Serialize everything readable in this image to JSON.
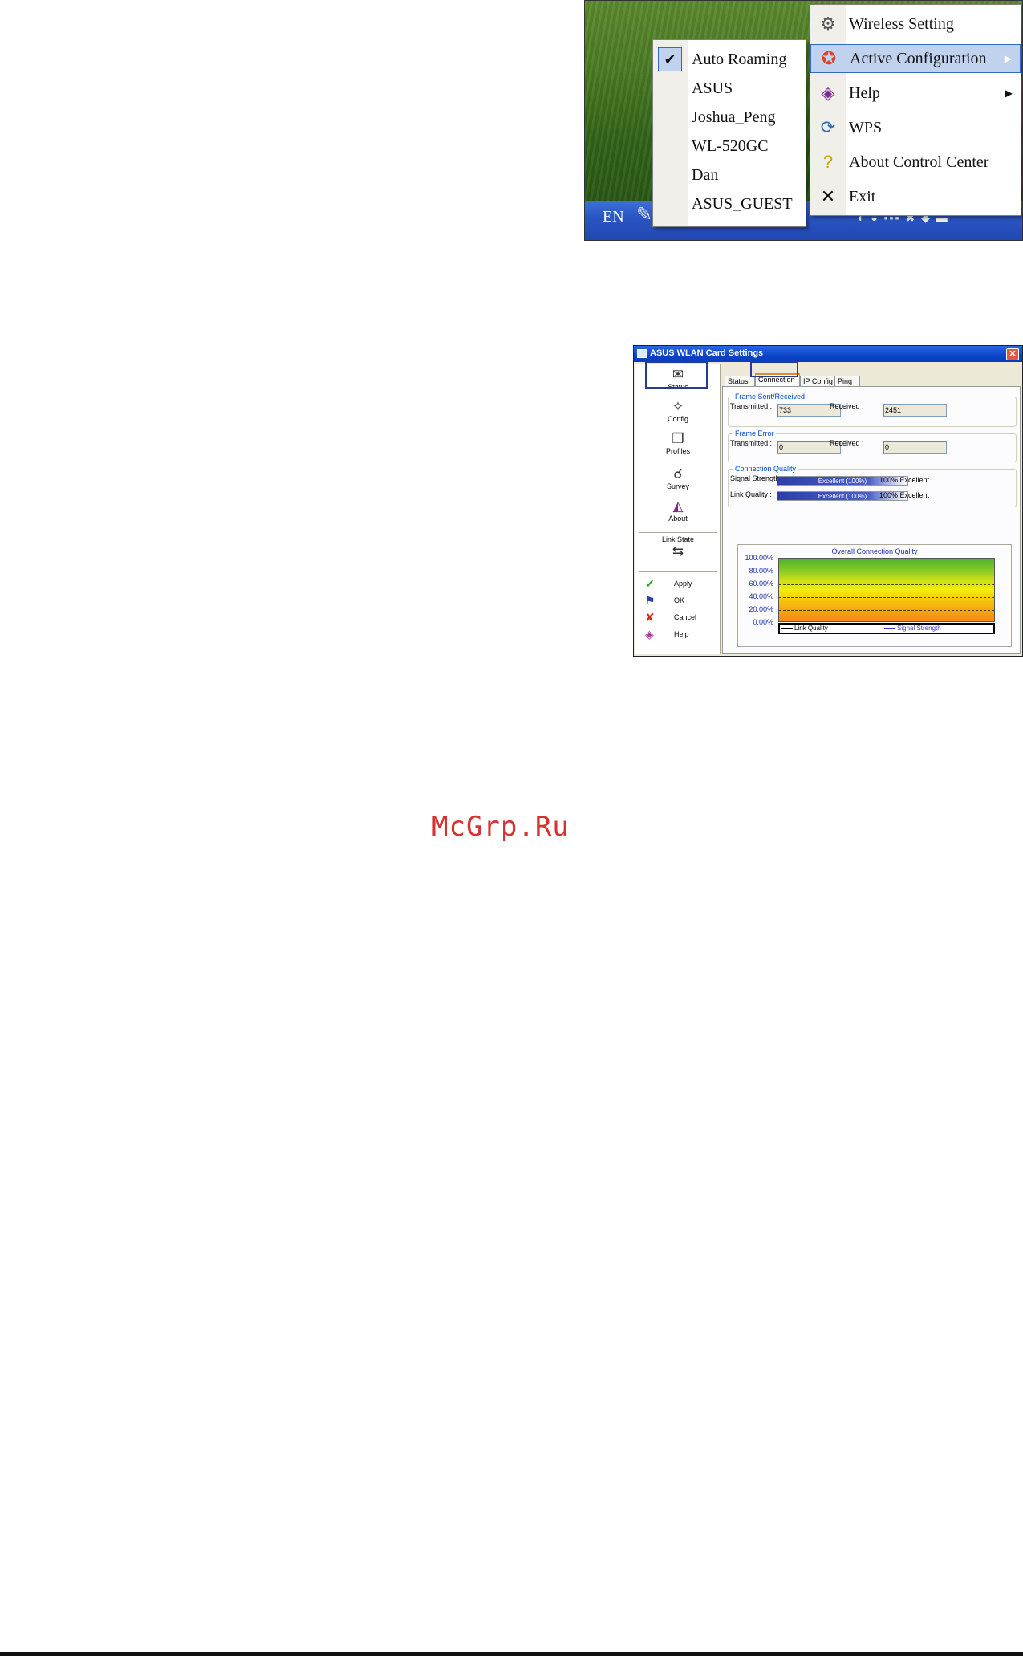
{
  "tray_screenshot": {
    "taskbar_lang": "EN",
    "main_menu": [
      {
        "label": "Wireless Setting",
        "icon": "network-settings-icon",
        "submenu": false,
        "highlighted": false
      },
      {
        "label": "Active Configuration",
        "icon": "target-icon",
        "submenu": true,
        "highlighted": true
      },
      {
        "label": "Help",
        "icon": "help-book-icon",
        "submenu": true,
        "highlighted": false
      },
      {
        "label": "WPS",
        "icon": "wps-icon",
        "submenu": false,
        "highlighted": false
      },
      {
        "label": "About Control Center",
        "icon": "question-icon",
        "submenu": false,
        "highlighted": false
      },
      {
        "label": "Exit",
        "icon": "close-icon",
        "submenu": false,
        "highlighted": false
      }
    ],
    "sub_menu": [
      {
        "label": "Auto Roaming",
        "checked": true
      },
      {
        "label": "ASUS",
        "checked": false
      },
      {
        "label": "Joshua_Peng",
        "checked": false
      },
      {
        "label": "WL-520GC",
        "checked": false
      },
      {
        "label": "Dan",
        "checked": false
      },
      {
        "label": "ASUS_GUEST",
        "checked": false
      }
    ]
  },
  "settings_screenshot": {
    "title": "ASUS WLAN Card Settings",
    "nav": {
      "items": [
        "Status",
        "Config",
        "Profiles",
        "Survey",
        "About"
      ],
      "link_state_label": "Link State",
      "actions": [
        "Apply",
        "OK",
        "Cancel",
        "Help"
      ]
    },
    "tabs": [
      "Status",
      "Connection",
      "IP Config",
      "Ping"
    ],
    "active_tab": "Connection",
    "frame_sent_received": {
      "title": "Frame Sent/Received",
      "transmitted_label": "Transmitted :",
      "transmitted_value": "733",
      "received_label": "Received :",
      "received_value": "2451"
    },
    "frame_error": {
      "title": "Frame Error",
      "transmitted_label": "Transmitted :",
      "transmitted_value": "0",
      "received_label": "Received :",
      "received_value": "0"
    },
    "connection_quality": {
      "title": "Connection Quality",
      "signal_label": "Signal Strength :",
      "signal_bar_text": "Excellent (100%)",
      "signal_value": "100% Excellent",
      "signal_fraction": 1.0,
      "link_label": "Link Quality :",
      "link_bar_text": "Excellent (100%)",
      "link_value": "100% Excellent",
      "link_fraction": 1.0
    },
    "overall_chart": {
      "title": "Overall Connection Quality",
      "y_ticks": [
        "100.00%",
        "80.00%",
        "60.00%",
        "40.00%",
        "20.00%",
        "0.00%"
      ],
      "legend": [
        {
          "name": "Link Quality",
          "color": "#000000"
        },
        {
          "name": "Signal Strength",
          "color": "#3a3ad0"
        }
      ]
    }
  },
  "watermark": "McGrp.Ru",
  "colors": {
    "highlight": "#c1d2ee",
    "title_bar": "#0a44c8",
    "group_title": "#0046d5"
  }
}
